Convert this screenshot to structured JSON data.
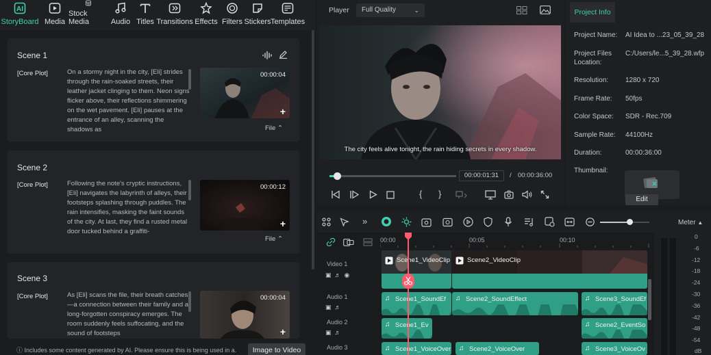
{
  "toolbar": {
    "items": [
      {
        "label": "StoryBoard",
        "icon": "storyboard-icon"
      },
      {
        "label": "Media",
        "icon": "media-icon"
      },
      {
        "label": "Stock Media",
        "icon": "stock-media-icon"
      },
      {
        "label": "Audio",
        "icon": "music-note-icon"
      },
      {
        "label": "Titles",
        "icon": "text-icon"
      },
      {
        "label": "Transitions",
        "icon": "transition-icon"
      },
      {
        "label": "Effects",
        "icon": "effects-icon"
      },
      {
        "label": "Filters",
        "icon": "filter-icon"
      },
      {
        "label": "Stickers",
        "icon": "sticker-icon"
      },
      {
        "label": "Templates",
        "icon": "template-icon"
      }
    ],
    "active": "StoryBoard"
  },
  "storyboard": {
    "scenes": [
      {
        "title": "Scene 1",
        "tag": "[Core Plot]",
        "text": "On a stormy night in the city, [Eli] strides through the rain-soaked streets, their leather jacket clinging to them. Neon signs flicker above, their reflections shimmering on the wet pavement. [Eli] pauses at the entrance of an alley, scanning the shadows as",
        "duration": "00:00:04",
        "file_label": "File"
      },
      {
        "title": "Scene 2",
        "tag": "[Core Plot]",
        "text": "Following the note's cryptic instructions, [Eli] navigates the labyrinth of alleys, their footsteps splashing through puddles. The rain intensifies, masking the faint sounds of the city. At last, they find a rusted metal door tucked behind a graffiti-",
        "duration": "00:00:12",
        "file_label": "File"
      },
      {
        "title": "Scene 3",
        "tag": "[Core Plot]",
        "text": "As [Eli] scans the file, their breath catches—a connection between their family and a long-forgotten conspiracy emerges. The room suddenly feels suffocating, and the sound of footsteps",
        "duration": "00:00:04"
      }
    ],
    "notice": "Includes some content generated by AI. Please ensure this is being used in a.",
    "image_to_video": "Image to Video"
  },
  "player": {
    "label": "Player",
    "quality": "Full Quality",
    "subtitle": "The city feels alive tonight, the rain hiding secrets in every shadow.",
    "current_time": "00:00:01:31",
    "separator": "/",
    "total_time": "00:00:36:00",
    "progress": 0.06
  },
  "project_info": {
    "tab": "Project Info",
    "rows": [
      {
        "key": "Project Name:",
        "value": "AI Idea to ...23_05_39_28"
      },
      {
        "key": "Project Files Location:",
        "value": "C:/Users/le...5_39_28.wfp"
      },
      {
        "key": "Resolution:",
        "value": "1280 x 720"
      },
      {
        "key": "Frame Rate:",
        "value": "50fps"
      },
      {
        "key": "Color Space:",
        "value": "SDR - Rec.709"
      },
      {
        "key": "Sample Rate:",
        "value": "44100Hz"
      },
      {
        "key": "Duration:",
        "value": "00:00:36:00"
      },
      {
        "key": "Thumbnail:",
        "value": ""
      }
    ],
    "edit_label": "Edit"
  },
  "timeline": {
    "ruler": [
      "00:00",
      "00:05",
      "00:10"
    ],
    "tracks": [
      {
        "name": "Video 1",
        "clips": [
          "Scene1_VideoClip",
          "Scene2_VideoClip"
        ]
      },
      {
        "name": "Audio 1",
        "clips": [
          "Scene1_SoundEf",
          "Scene2_SoundEffect",
          "Scene3_SoundEf"
        ]
      },
      {
        "name": "Audio 2",
        "clips": [
          "Scene1_Ev",
          "Scene2_EventSo"
        ]
      },
      {
        "name": "Audio 3",
        "clips": [
          "Scene1_VoiceOver",
          "Scene2_VoiceOver",
          "Scene3_VoiceOv"
        ]
      }
    ],
    "zoom": 0.6
  },
  "meter": {
    "label": "Meter",
    "scale": [
      "0",
      "-6",
      "-12",
      "-18",
      "-24",
      "-30",
      "-36",
      "-42",
      "-48",
      "-54",
      "dB"
    ]
  },
  "colors": {
    "accent": "#3fd0b0",
    "playhead": "#ff5b6e",
    "clip": "#2f9f86"
  }
}
